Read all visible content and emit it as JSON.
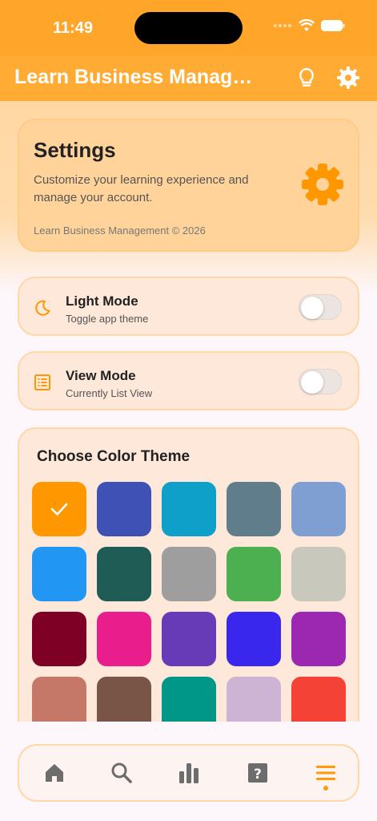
{
  "status": {
    "time": "11:49"
  },
  "header": {
    "title": "Learn Business Manag…",
    "icons": [
      "lightbulb-icon",
      "gear-icon"
    ]
  },
  "settings_card": {
    "title": "Settings",
    "description": "Customize your learning experience and manage your account.",
    "copyright": "Learn Business Management © 2026",
    "icon": "gear-icon"
  },
  "toggles": [
    {
      "title": "Light Mode",
      "subtitle": "Toggle app theme",
      "icon": "moon-icon",
      "on": false
    },
    {
      "title": "View Mode",
      "subtitle": "Currently List View",
      "icon": "list-icon",
      "on": false
    }
  ],
  "theme": {
    "title": "Choose Color Theme",
    "selected_index": 0,
    "swatches": [
      "#ff9800",
      "#3f51b5",
      "#0ea0c9",
      "#607d8b",
      "#7f9fd3",
      "#2196f3",
      "#1f5c55",
      "#9e9e9e",
      "#4caf50",
      "#c8c8bc",
      "#7f0025",
      "#e91e8c",
      "#673ab7",
      "#3927ee",
      "#9c27b0",
      "#c57868",
      "#795548",
      "#009688",
      "#cdb3d4",
      "#f44336"
    ]
  },
  "nav": {
    "items": [
      "home-icon",
      "search-icon",
      "stats-icon",
      "help-icon",
      "menu-icon"
    ],
    "active_index": 4
  },
  "colors": {
    "accent": "#ff9a0a",
    "header": "#ffab34"
  }
}
